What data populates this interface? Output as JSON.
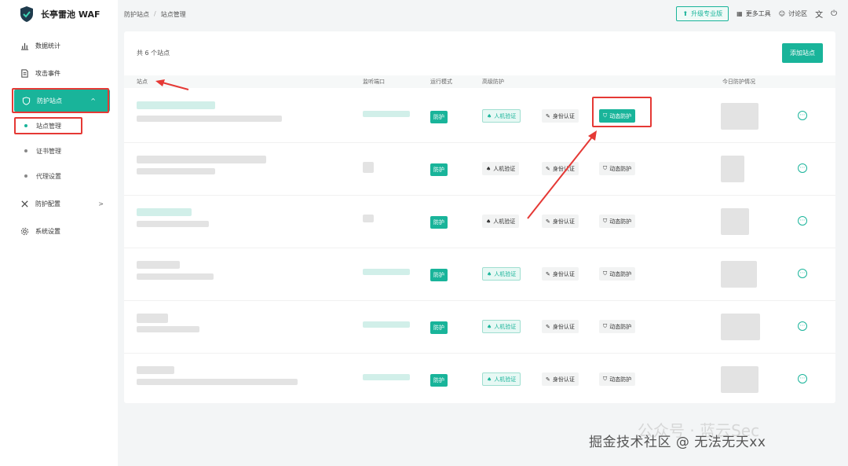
{
  "brand": {
    "name": "长亭雷池 WAF"
  },
  "sidebar": {
    "items": [
      {
        "label": "数据统计",
        "icon": "bar-chart-icon"
      },
      {
        "label": "攻击事件",
        "icon": "document-icon"
      },
      {
        "label": "防护站点",
        "icon": "shield-icon",
        "active": true
      },
      {
        "label": "防护配置",
        "icon": "tools-icon"
      },
      {
        "label": "系统设置",
        "icon": "gear-icon"
      }
    ],
    "sub_items": [
      {
        "label": "站点管理",
        "active": true
      },
      {
        "label": "证书管理"
      },
      {
        "label": "代理设置"
      }
    ]
  },
  "breadcrumb": {
    "parent": "防护站点",
    "sep": "/",
    "current": "站点管理"
  },
  "topbar": {
    "upgrade": "升级专业版",
    "more_tools": "更多工具",
    "forum": "讨论区"
  },
  "main": {
    "site_count": "共 6 个站点",
    "add_button": "添加站点",
    "columns": [
      "站点",
      "监听端口",
      "运行模式",
      "高级防护",
      "今日防护情况"
    ]
  },
  "rows": [
    {
      "mode": "防护",
      "captcha": "人机验证",
      "auth": "身份认证",
      "dynamic": "动态防护",
      "captcha_on": true,
      "dynamic_on": true
    },
    {
      "mode": "防护",
      "captcha": "人机验证",
      "auth": "身份认证",
      "dynamic": "动态防护",
      "captcha_on": false,
      "dynamic_on": false
    },
    {
      "mode": "防护",
      "captcha": "人机验证",
      "auth": "身份认证",
      "dynamic": "动态防护",
      "captcha_on": false,
      "dynamic_on": false
    },
    {
      "mode": "防护",
      "captcha": "人机验证",
      "auth": "身份认证",
      "dynamic": "动态防护",
      "captcha_on": true,
      "dynamic_on": false
    },
    {
      "mode": "防护",
      "captcha": "人机验证",
      "auth": "身份认证",
      "dynamic": "动态防护",
      "captcha_on": true,
      "dynamic_on": false
    },
    {
      "mode": "防护",
      "captcha": "人机验证",
      "auth": "身份认证",
      "dynamic": "动态防护",
      "captcha_on": true,
      "dynamic_on": false
    }
  ],
  "watermark": {
    "text": "掘金技术社区 @ 无法无天xx",
    "ghost": "公众号 · 蓝云Sec"
  },
  "colors": {
    "accent": "#19b49a",
    "highlight": "#e53935"
  }
}
